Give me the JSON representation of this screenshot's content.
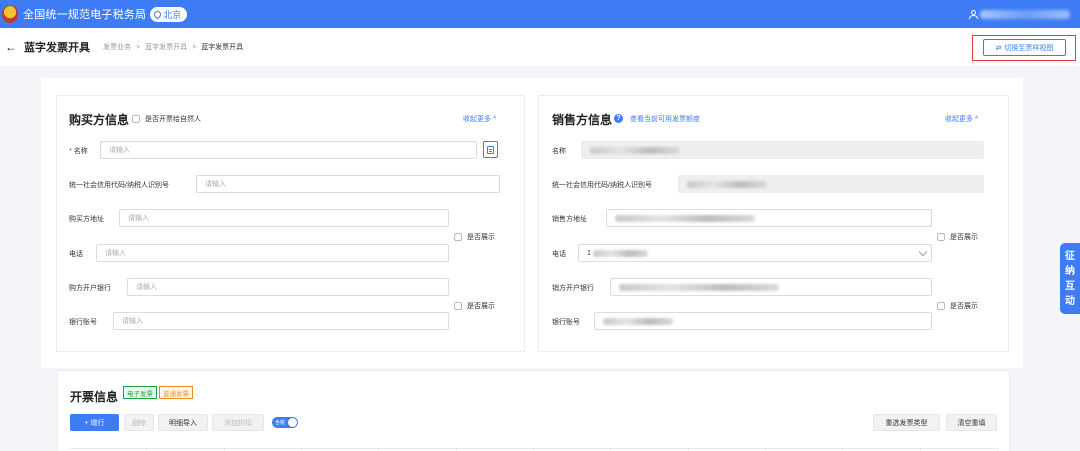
{
  "app": {
    "brand": "全国统一规范电子税务局",
    "region": "北京",
    "icons": {
      "emblem": "tax-emblem",
      "location": "location-pin-icon",
      "user": "user-icon"
    }
  },
  "header": {
    "back_icon": "←",
    "title": "蓝字发票开具",
    "breadcrumb": [
      "发票业务",
      "蓝字发票开具",
      "蓝字发票开具"
    ],
    "breadcrumb_sep": ">",
    "switch_icon": "⇄",
    "switch_label": "切换至票样视图"
  },
  "buyer": {
    "title": "购买方信息",
    "natural_person_label": "是否开票给自然人",
    "collapse_label": "收起更多 ^",
    "fields": {
      "name_required": "*",
      "name_label": "名称",
      "name_placeholder": "请输入",
      "tax_id_label": "统一社会信用代码/纳税人识别号",
      "tax_id_placeholder": "请输入",
      "address_label": "购买方地址",
      "address_placeholder": "请输入",
      "phone_label": "电话",
      "phone_placeholder": "请输入",
      "show_label_1": "是否展示",
      "bank_label": "购方开户银行",
      "bank_placeholder": "请输入",
      "account_label": "银行账号",
      "account_placeholder": "请输入",
      "show_label_2": "是否展示"
    }
  },
  "seller": {
    "title": "销售方信息",
    "help_icon": "?",
    "quota_link": "查看当前可用发票额度",
    "collapse_label": "收起更多 ^",
    "fields": {
      "name_label": "名称",
      "tax_id_label": "统一社会信用代码/纳税人识别号",
      "address_label": "销售方地址",
      "phone_label": "电话",
      "phone_prefix": "1",
      "show_label_1": "是否展示",
      "bank_label": "销方开户银行",
      "account_label": "银行账号",
      "show_label_2": "是否展示"
    }
  },
  "invoice": {
    "title": "开票信息",
    "tags": [
      "电子发票",
      "普通发票"
    ],
    "buttons": {
      "add_row": "+ 增行",
      "delete": "删除",
      "import": "明细导入",
      "discount": "添加折扣",
      "tax_toggle": "含税",
      "reselect": "重选发票类型",
      "clear": "清空重填"
    }
  },
  "side_float": {
    "chars": [
      "征",
      "纳",
      "互",
      "动"
    ]
  },
  "colors": {
    "primary": "#3d7cf4",
    "highlight_frame": "#e53935",
    "tag_green": "#1f9d3a",
    "tag_orange": "#f08a24"
  }
}
